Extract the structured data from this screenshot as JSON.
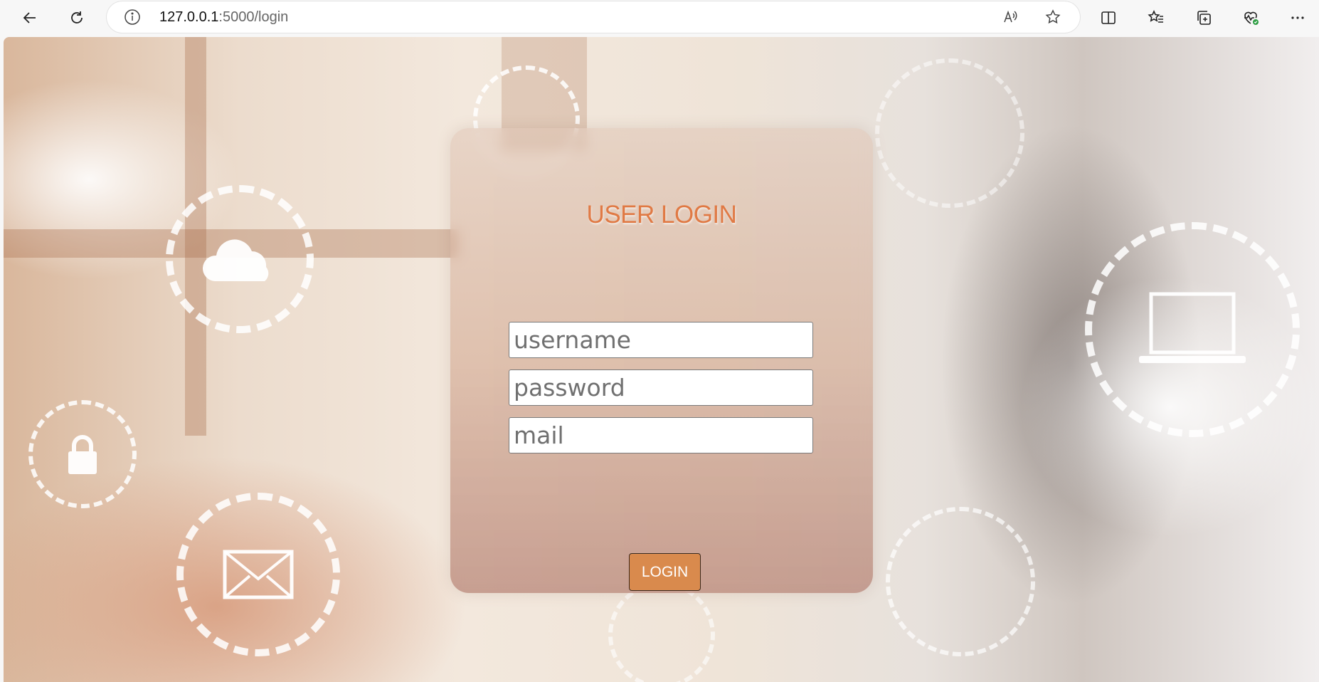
{
  "browser": {
    "url_host": "127.0.0.1",
    "url_rest": ":5000/login",
    "icons": [
      "back-icon",
      "refresh-icon",
      "info-icon",
      "read-aloud-icon",
      "favorite-star-icon",
      "split-screen-icon",
      "favorites-icon",
      "collections-icon",
      "browser-essentials-icon",
      "more-icon"
    ]
  },
  "login": {
    "title": "USER LOGIN",
    "username_placeholder": "username",
    "password_placeholder": "password",
    "mail_placeholder": "mail",
    "button_label": "LOGIN",
    "accent_color": "#e07a45",
    "button_color": "#d98a4d"
  }
}
